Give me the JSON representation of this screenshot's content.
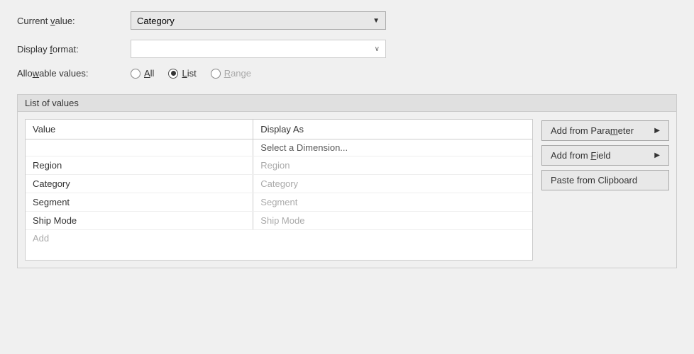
{
  "form": {
    "current_value_label": "Current value:",
    "current_value_underline": "v",
    "current_value_selected": "Category",
    "display_format_label": "Display format:",
    "display_format_underline": "f",
    "display_format_value": "",
    "allowable_values_label": "Allowable values:",
    "allowable_values_underline": "w",
    "radio_all_label": "All",
    "radio_all_underline": "A",
    "radio_list_label": "List",
    "radio_list_underline": "L",
    "radio_range_label": "Range",
    "radio_range_underline": "R"
  },
  "list_section": {
    "header": "List of values",
    "table": {
      "col_value": "Value",
      "col_display": "Display As",
      "subheader_text": "Select a Dimension...",
      "rows": [
        {
          "value": "Region",
          "display": "Region"
        },
        {
          "value": "Category",
          "display": "Category"
        },
        {
          "value": "Segment",
          "display": "Segment"
        },
        {
          "value": "Ship Mode",
          "display": "Ship Mode"
        }
      ],
      "add_placeholder": "Add"
    },
    "buttons": {
      "add_from_parameter": "Add from Para­meter",
      "add_from_field": "Add from Field",
      "paste_from_clipboard": "Paste from Clipboard"
    }
  }
}
